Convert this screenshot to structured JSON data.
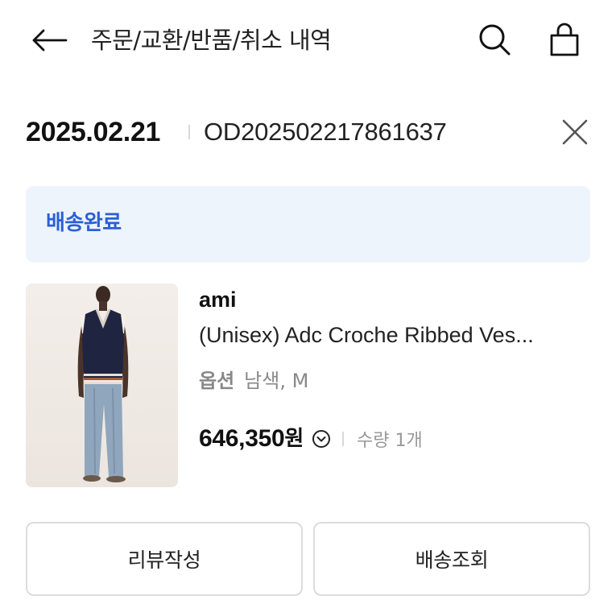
{
  "header": {
    "title": "주문/교환/반품/취소 내역",
    "back_icon": "arrow-left-icon",
    "search_icon": "search-icon",
    "cart_icon": "shopping-bag-icon"
  },
  "order": {
    "date": "2025.02.21",
    "number": "OD202502217861637",
    "close_icon": "close-icon"
  },
  "status": {
    "label": "배송완료",
    "color": "#2b5fd6",
    "background": "#eef4fb"
  },
  "product": {
    "brand": "ami",
    "name": "(Unisex) Adc Croche Ribbed Ves...",
    "option_label": "옵션",
    "option_value": "남색, M",
    "price": "646,350",
    "currency": "원",
    "price_toggle_icon": "chevron-down-circle-icon",
    "quantity": "수량 1개"
  },
  "actions": {
    "review_label": "리뷰작성",
    "track_label": "배송조회"
  }
}
